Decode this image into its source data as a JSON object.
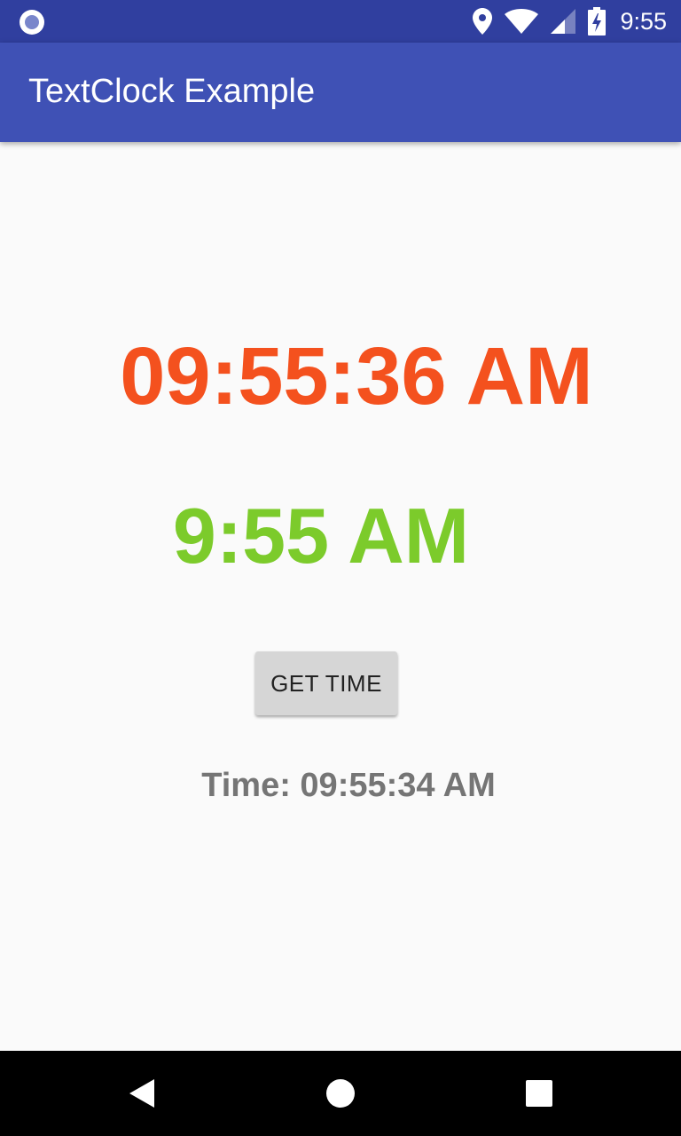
{
  "status_bar": {
    "time": "9:55",
    "icons": [
      "notification-dot-icon",
      "location-icon",
      "wifi-icon",
      "signal-icon",
      "battery-charging-icon"
    ]
  },
  "app_bar": {
    "title": "TextClock Example"
  },
  "main": {
    "clock_full": "09:55:36 AM",
    "clock_short": "9:55 AM",
    "get_time_button": "GET TIME",
    "time_result": "Time: 09:55:34 AM"
  },
  "nav_bar": {
    "icons": [
      "back-icon",
      "home-icon",
      "recents-icon"
    ]
  },
  "colors": {
    "status_bar": "#303f9f",
    "app_bar": "#3f51b5",
    "clock_full": "#f4511e",
    "clock_short": "#7ccb2b",
    "time_result": "#757575",
    "button": "#d6d6d6"
  }
}
